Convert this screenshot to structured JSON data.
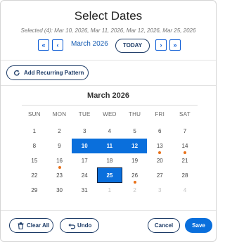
{
  "dialog": {
    "title": "Select Dates",
    "subtitle": "Selected (4): Mar 10, 2026, Mar 11, 2026, Mar 12, 2026, Mar 25, 2026"
  },
  "nav": {
    "prev_year": "«",
    "prev_month": "‹",
    "month_label": "March 2026",
    "today": "TODAY",
    "next_month": "›",
    "next_year": "»"
  },
  "recurring": {
    "label": "Add Recurring Pattern",
    "icon": "repeat-icon"
  },
  "calendar": {
    "title": "March 2026",
    "weekdays": [
      "SUN",
      "MON",
      "TUE",
      "WED",
      "THU",
      "FRI",
      "SAT"
    ],
    "weeks": [
      [
        {
          "d": "1"
        },
        {
          "d": "2"
        },
        {
          "d": "3"
        },
        {
          "d": "4"
        },
        {
          "d": "5"
        },
        {
          "d": "6"
        },
        {
          "d": "7"
        }
      ],
      [
        {
          "d": "8"
        },
        {
          "d": "9"
        },
        {
          "d": "10",
          "state": "selected"
        },
        {
          "d": "11",
          "state": "selected"
        },
        {
          "d": "12",
          "state": "selected"
        },
        {
          "d": "13",
          "dot": true
        },
        {
          "d": "14",
          "dot": true
        }
      ],
      [
        {
          "d": "15"
        },
        {
          "d": "16",
          "dot": true
        },
        {
          "d": "17"
        },
        {
          "d": "18"
        },
        {
          "d": "19"
        },
        {
          "d": "20"
        },
        {
          "d": "21"
        }
      ],
      [
        {
          "d": "22"
        },
        {
          "d": "23"
        },
        {
          "d": "24"
        },
        {
          "d": "25",
          "state": "today-selected"
        },
        {
          "d": "26",
          "dot": true
        },
        {
          "d": "27"
        },
        {
          "d": "28"
        }
      ],
      [
        {
          "d": "29"
        },
        {
          "d": "30"
        },
        {
          "d": "31"
        },
        {
          "d": "1",
          "muted": true
        },
        {
          "d": "2",
          "muted": true
        },
        {
          "d": "3",
          "muted": true
        },
        {
          "d": "4",
          "muted": true
        }
      ]
    ],
    "colors": {
      "selected": "#0a6fdc",
      "event_dot": "#e8711a"
    }
  },
  "footer": {
    "clear_all": "Clear All",
    "undo": "Undo",
    "cancel": "Cancel",
    "save": "Save"
  }
}
